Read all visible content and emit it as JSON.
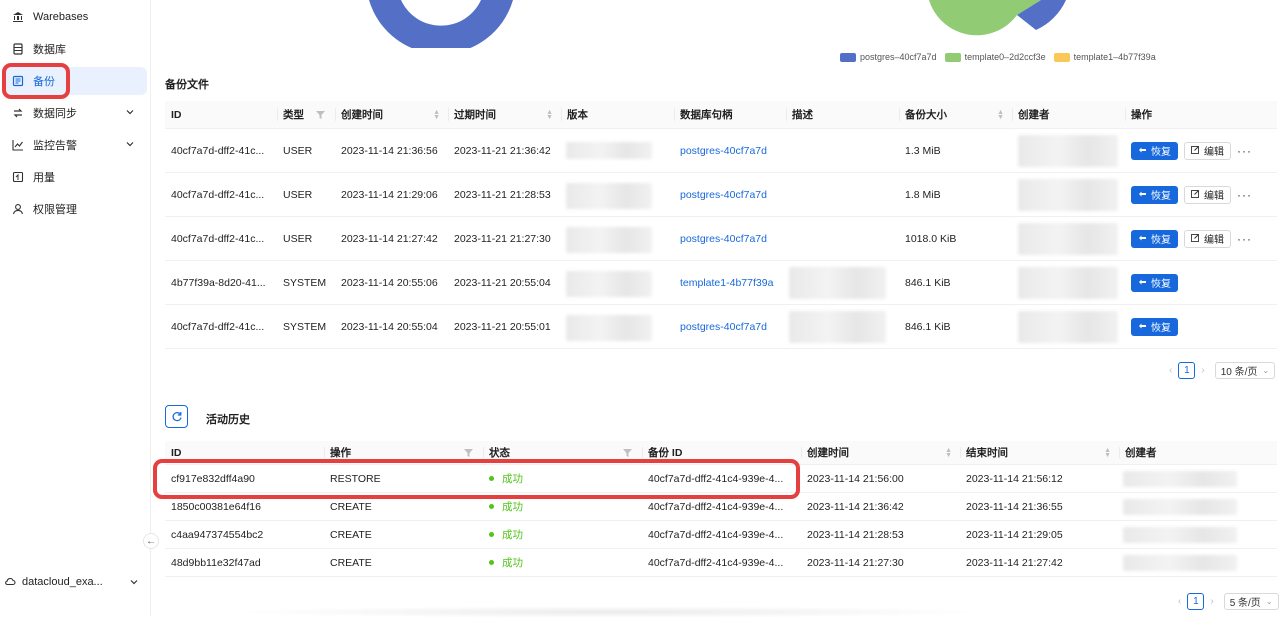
{
  "sidebar": {
    "items": [
      {
        "label": "Warebases",
        "icon": "bank-icon"
      },
      {
        "label": "数据库",
        "icon": "database-icon"
      },
      {
        "label": "备份",
        "icon": "backup-icon",
        "active": true
      },
      {
        "label": "数据同步",
        "icon": "sync-icon",
        "expandable": true
      },
      {
        "label": "监控告警",
        "icon": "monitor-chart-icon",
        "expandable": true
      },
      {
        "label": "用量",
        "icon": "usage-icon"
      },
      {
        "label": "权限管理",
        "icon": "user-icon"
      }
    ],
    "workspace": "datacloud_exa...",
    "collapse_glyph": "←"
  },
  "colors": {
    "accent": "#1668dc",
    "success": "#52c41a",
    "highlight": "#e53f3f",
    "postgres": "#5470c6",
    "template0": "#91cc75",
    "template1": "#fac858"
  },
  "chart_legend": [
    {
      "label": "postgres–40cf7a7d",
      "color": "#5470c6"
    },
    {
      "label": "template0–2d2ccf3e",
      "color": "#91cc75"
    },
    {
      "label": "template1–4b77f39a",
      "color": "#fac858"
    }
  ],
  "backup_files": {
    "title": "备份文件",
    "columns": [
      "ID",
      "类型",
      "创建时间",
      "过期时间",
      "版本",
      "数据库句柄",
      "描述",
      "备份大小",
      "创建者",
      "操作"
    ],
    "rows": [
      {
        "id": "40cf7a7d-dff2-41c...",
        "type": "USER",
        "created": "2023-11-14 21:36:56",
        "expires": "2023-11-21 21:36:42",
        "handle": "postgres-40cf7a7d",
        "size": "1.3 MiB",
        "has_edit": true
      },
      {
        "id": "40cf7a7d-dff2-41c...",
        "type": "USER",
        "created": "2023-11-14 21:29:06",
        "expires": "2023-11-21 21:28:53",
        "handle": "postgres-40cf7a7d",
        "size": "1.8 MiB",
        "has_edit": true
      },
      {
        "id": "40cf7a7d-dff2-41c...",
        "type": "USER",
        "created": "2023-11-14 21:27:42",
        "expires": "2023-11-21 21:27:30",
        "handle": "postgres-40cf7a7d",
        "size": "1018.0 KiB",
        "has_edit": true
      },
      {
        "id": "4b77f39a-8d20-41...",
        "type": "SYSTEM",
        "created": "2023-11-14 20:55:06",
        "expires": "2023-11-21 20:55:04",
        "handle": "template1-4b77f39a",
        "size": "846.1 KiB",
        "has_edit": false
      },
      {
        "id": "40cf7a7d-dff2-41c...",
        "type": "SYSTEM",
        "created": "2023-11-14 20:55:04",
        "expires": "2023-11-21 20:55:01",
        "handle": "postgres-40cf7a7d",
        "size": "846.1 KiB",
        "has_edit": false
      }
    ],
    "restore_label": "恢复",
    "edit_label": "编辑",
    "more_label": "···",
    "pagination": {
      "page": "1",
      "page_size": "10 条/页"
    }
  },
  "activity": {
    "title": "活动历史",
    "columns": [
      "ID",
      "操作",
      "状态",
      "备份 ID",
      "创建时间",
      "结束时间",
      "创建者"
    ],
    "rows": [
      {
        "id": "cf917e832dff4a90",
        "op": "RESTORE",
        "status": "成功",
        "backup_id": "40cf7a7d-dff2-41c4-939e-4...",
        "created": "2023-11-14 21:56:00",
        "ended": "2023-11-14 21:56:12"
      },
      {
        "id": "1850c00381e64f16",
        "op": "CREATE",
        "status": "成功",
        "backup_id": "40cf7a7d-dff2-41c4-939e-4...",
        "created": "2023-11-14 21:36:42",
        "ended": "2023-11-14 21:36:55"
      },
      {
        "id": "c4aa947374554bc2",
        "op": "CREATE",
        "status": "成功",
        "backup_id": "40cf7a7d-dff2-41c4-939e-4...",
        "created": "2023-11-14 21:28:53",
        "ended": "2023-11-14 21:29:05"
      },
      {
        "id": "48d9bb11e32f47ad",
        "op": "CREATE",
        "status": "成功",
        "backup_id": "40cf7a7d-dff2-41c4-939e-4...",
        "created": "2023-11-14 21:27:30",
        "ended": "2023-11-14 21:27:42"
      }
    ],
    "pagination": {
      "page": "1",
      "page_size": "5 条/页"
    }
  },
  "pager_prev": "‹",
  "pager_next": "›",
  "chevron_down": "⌄"
}
